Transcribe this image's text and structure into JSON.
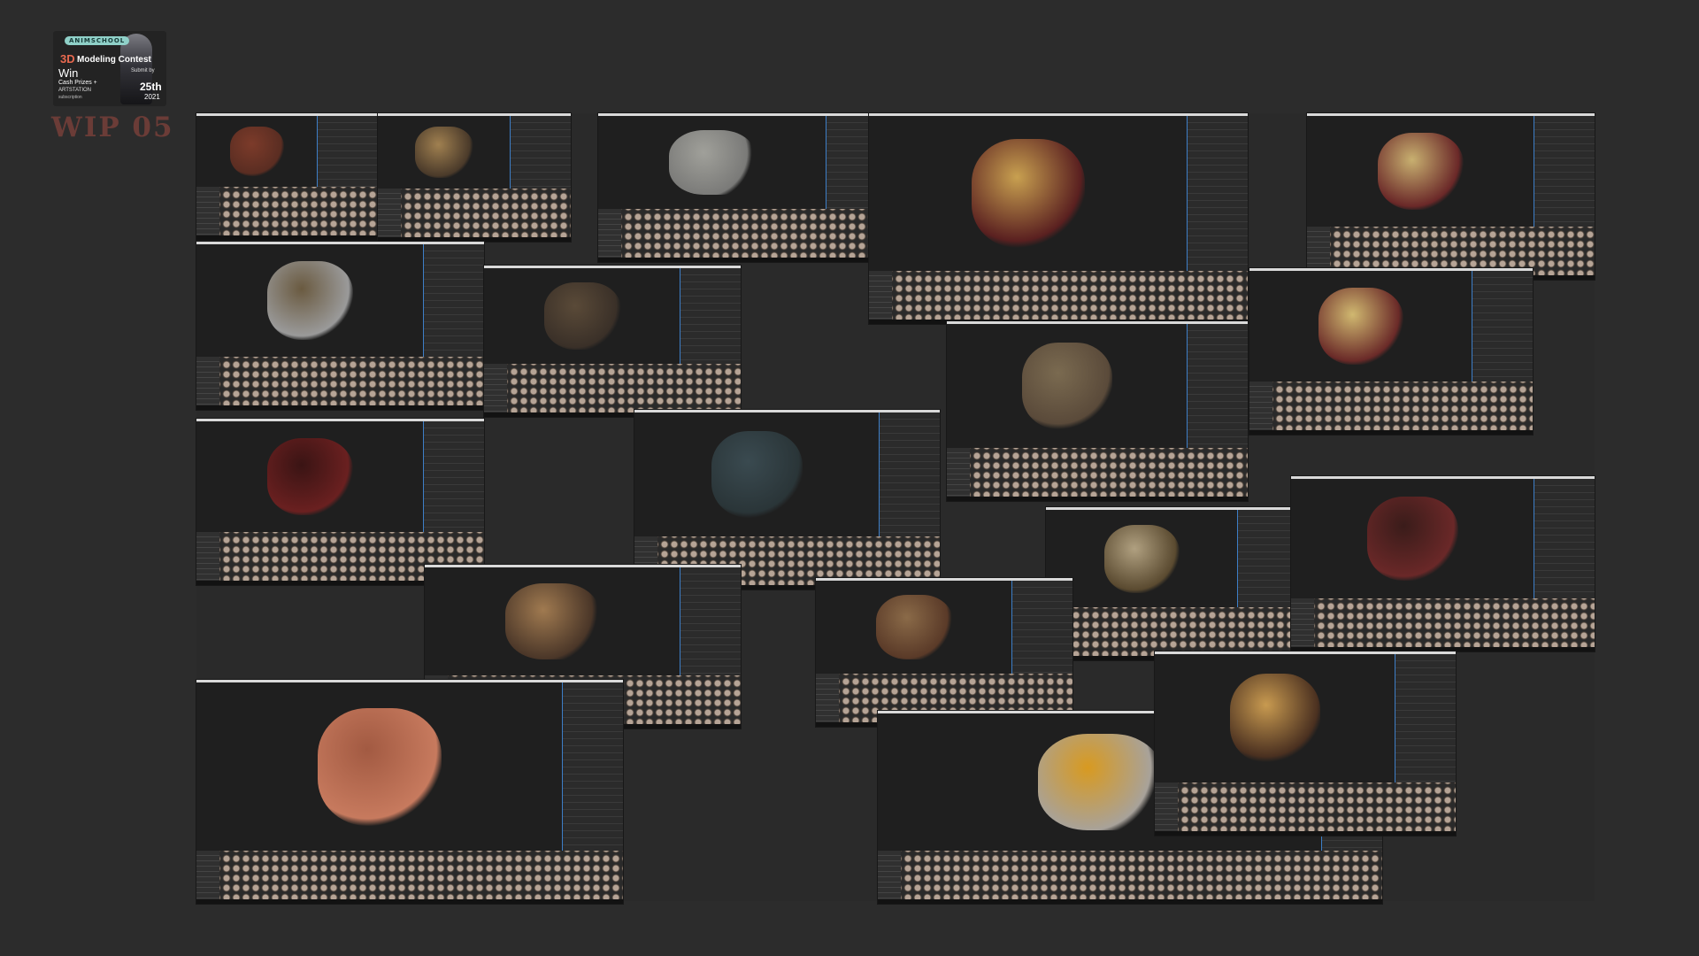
{
  "badge": {
    "school": "ANIMSCHOOL",
    "title_3d": "3D",
    "title_rest": "Modeling Contest",
    "win": "Win",
    "cash": "Cash Prizes +",
    "artstation": "ARTSTATION",
    "artstation_sub": "subscription",
    "submit": "Submit by",
    "day": "25th",
    "year": "2021"
  },
  "heading": "WIP 05",
  "screenshots": [
    {
      "id": "bracer-small",
      "colors": [
        "#5a2d22",
        "#7c3b2a"
      ]
    },
    {
      "id": "belt-ring",
      "colors": [
        "#4a3a2a",
        "#a08050"
      ]
    },
    {
      "id": "hammer",
      "colors": [
        "#7a7a78",
        "#a0a09a"
      ]
    },
    {
      "id": "straps-uv",
      "colors": [
        "#5a2020",
        "#c8a050"
      ]
    },
    {
      "id": "arm-wrap-1",
      "colors": [
        "#6a2828",
        "#c8b070"
      ]
    },
    {
      "id": "fur-belt",
      "colors": [
        "#9a9a9a",
        "#6a5a40"
      ]
    },
    {
      "id": "boots",
      "colors": [
        "#3a3028",
        "#5a4a38"
      ]
    },
    {
      "id": "arm-wrap-2",
      "colors": [
        "#6a2a28",
        "#d0b870"
      ]
    },
    {
      "id": "chain-pad",
      "colors": [
        "#5a4a3a",
        "#7a6a50"
      ]
    },
    {
      "id": "red-gauntlet",
      "colors": [
        "#6a2020",
        "#3a1414"
      ]
    },
    {
      "id": "cloth-pants",
      "colors": [
        "#2a3538",
        "#3a4a50"
      ]
    },
    {
      "id": "dagger",
      "colors": [
        "#5a4a30",
        "#b0a080"
      ]
    },
    {
      "id": "bracer-large",
      "colors": [
        "#6a2828",
        "#3a1c1a"
      ]
    },
    {
      "id": "belt-holster",
      "colors": [
        "#4a3628",
        "#a07a50"
      ]
    },
    {
      "id": "sling",
      "colors": [
        "#5a3a28",
        "#8a6a48"
      ]
    },
    {
      "id": "troll-render",
      "colors": [
        "#c77a5e",
        "#a25a42"
      ]
    },
    {
      "id": "dwarf-sculpt",
      "colors": [
        "#a8a29a",
        "#d89a20"
      ]
    },
    {
      "id": "belt-rings",
      "colors": [
        "#4a3020",
        "#c89a50"
      ]
    }
  ]
}
